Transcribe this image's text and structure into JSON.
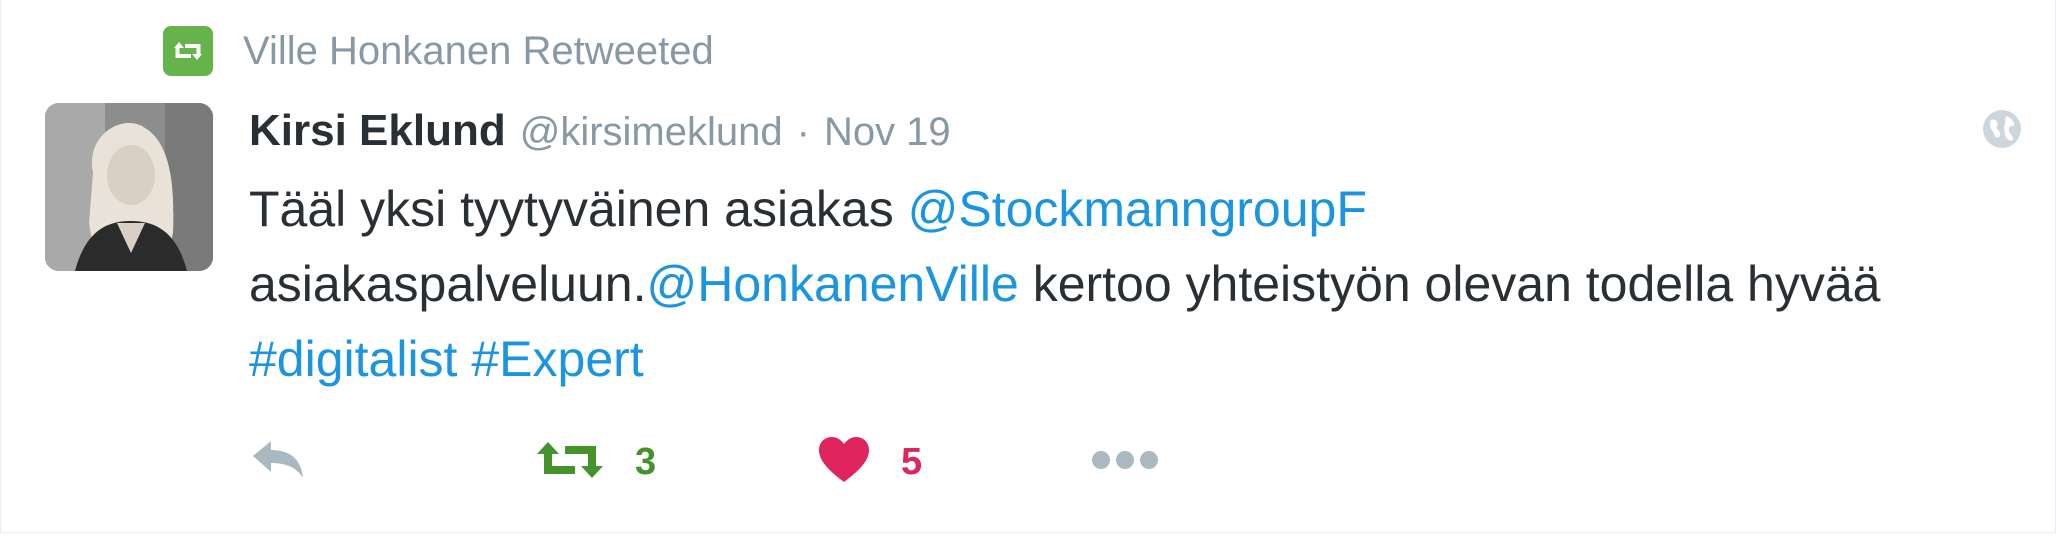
{
  "retweet_context": {
    "text": "Ville Honkanen Retweeted",
    "icon": "retweet-icon",
    "badge_color": "#66b34b"
  },
  "author": {
    "fullname": "Kirsi Eklund",
    "username": "@kirsimeklund",
    "separator": "·",
    "timestamp": "Nov 19",
    "avatar_icon": "avatar-photo"
  },
  "text": {
    "part1": "Tääl yksi tyytyväinen asiakas ",
    "mention1": "@StockmanngroupF",
    "part2": "asiakaspalveluun.",
    "mention2": "@HonkanenVille",
    "part3": " kertoo yhteistyön olevan todella hyvää ",
    "hashtag1": "#digitalist",
    "space": " ",
    "hashtag2": "#Expert"
  },
  "actions": {
    "reply_icon": "reply-icon",
    "retweet_icon": "retweet-icon",
    "retweet_count": "3",
    "like_icon": "heart-icon",
    "like_count": "5",
    "more_icon": "more-dots-icon"
  },
  "colors": {
    "link": "#1b95e0",
    "retweet_green": "#44942b",
    "like_red": "#e0245e",
    "muted": "#8899a6"
  }
}
